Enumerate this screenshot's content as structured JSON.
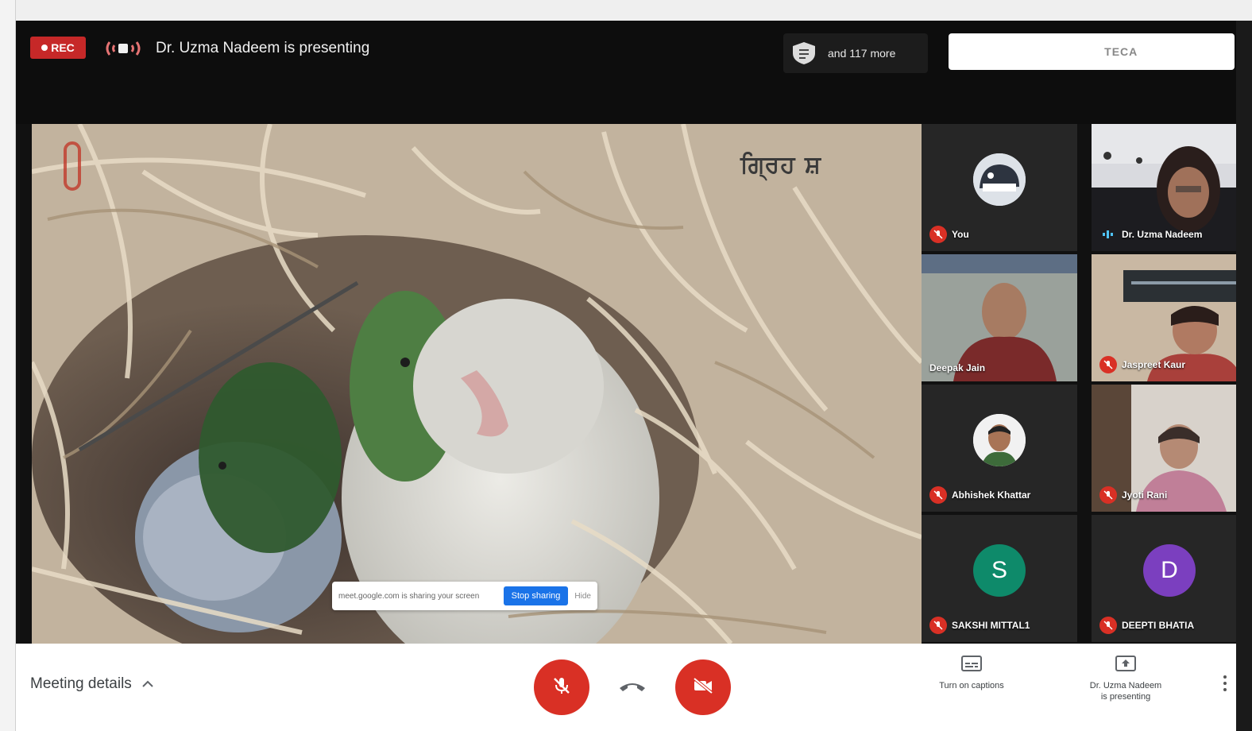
{
  "header": {
    "rec_label": "REC",
    "presenting_title": "Dr. Uzma Nadeem is presenting",
    "viewers_caption": "",
    "viewers_count": "and 117 more",
    "logos": [
      "",
      "",
      "TECA",
      ""
    ]
  },
  "stage": {
    "watermark": "ਗ੍ਰਿਹ ਸ਼",
    "share_message": "meet.google.com is sharing your screen",
    "stop_sharing_label": "Stop sharing",
    "hide_label": "Hide"
  },
  "tiles": [
    {
      "name": "You",
      "mic": "off",
      "kind": "avatar-photo"
    },
    {
      "name": "Dr. Uzma Nadeem",
      "mic": "on",
      "kind": "video"
    },
    {
      "name": "Deepak Jain",
      "mic": "none",
      "kind": "video"
    },
    {
      "name": "Jaspreet Kaur",
      "mic": "off",
      "kind": "video"
    },
    {
      "name": "Abhishek Khattar",
      "mic": "off",
      "kind": "avatar-photo"
    },
    {
      "name": "Jyoti Rani",
      "mic": "off",
      "kind": "video"
    },
    {
      "name": "SAKSHI MITTAL1",
      "mic": "off",
      "kind": "letter",
      "letter": "S",
      "color": "#0e8a6a"
    },
    {
      "name": "DEEPTI BHATIA",
      "mic": "off",
      "kind": "letter",
      "letter": "D",
      "color": "#7b3fbf"
    }
  ],
  "bottom": {
    "meeting_details": "Meeting details",
    "captions_label": "Turn on captions",
    "present_label_line1": "Dr. Uzma Nadeem",
    "present_label_line2": "is presenting"
  },
  "colors": {
    "danger": "#d93025",
    "primary": "#1a73e8",
    "rec": "#c62828"
  }
}
